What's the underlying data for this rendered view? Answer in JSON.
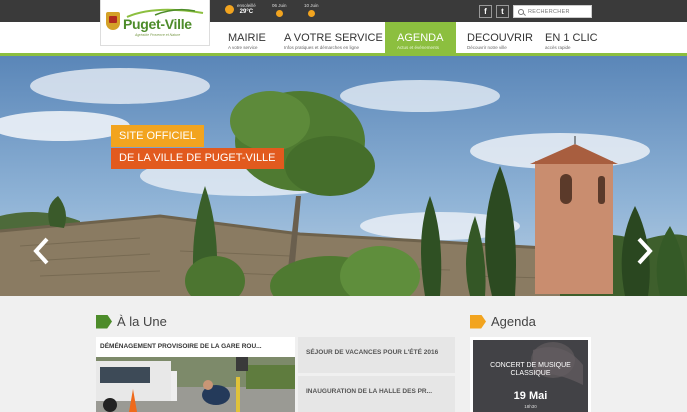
{
  "weather": [
    {
      "icon": "sun-icon",
      "label": "ensoleillé",
      "value": "29°C"
    },
    {
      "icon": "sun-small-icon",
      "label": "06 Juin",
      "value": ""
    },
    {
      "icon": "sun-small-icon",
      "label": "10 Juin",
      "value": ""
    }
  ],
  "social": {
    "facebook": "f",
    "twitter": "t"
  },
  "search": {
    "placeholder": "RECHERCHER"
  },
  "logo": {
    "name": "Puget-Ville",
    "tagline": "Agréable Provence et Nature"
  },
  "nav": [
    {
      "label": "MAIRIE",
      "sub": "A votre service"
    },
    {
      "label": "A VOTRE SERVICE",
      "sub": "Infos pratiques et démarches en ligne"
    },
    {
      "label": "AGENDA",
      "sub": "Actus et événements"
    },
    {
      "label": "DECOUVRIR",
      "sub": "Découvrir notre ville"
    },
    {
      "label": "EN 1 CLIC",
      "sub": "accès rapide"
    }
  ],
  "hero": {
    "banner_line1": "SITE OFFICIEL",
    "banner_line2": "DE LA VILLE DE PUGET-VILLE"
  },
  "une": {
    "title": "À la Une",
    "main_headline": "DÉMÉNAGEMENT PROVISOIRE DE LA GARE ROU...",
    "items": [
      "SÉJOUR DE VACANCES POUR L'ÉTÉ 2016",
      "INAUGURATION DE LA HALLE DES PR..."
    ]
  },
  "agenda": {
    "title": "Agenda",
    "event": "CONCERT DE MUSIQUE CLASSIQUE",
    "date": "19 Mai",
    "time": "18h30"
  },
  "colors": {
    "green": "#8cbf3f",
    "orange": "#f2a41f",
    "red_orange": "#e25a1e",
    "dark": "#3a3a3a"
  }
}
